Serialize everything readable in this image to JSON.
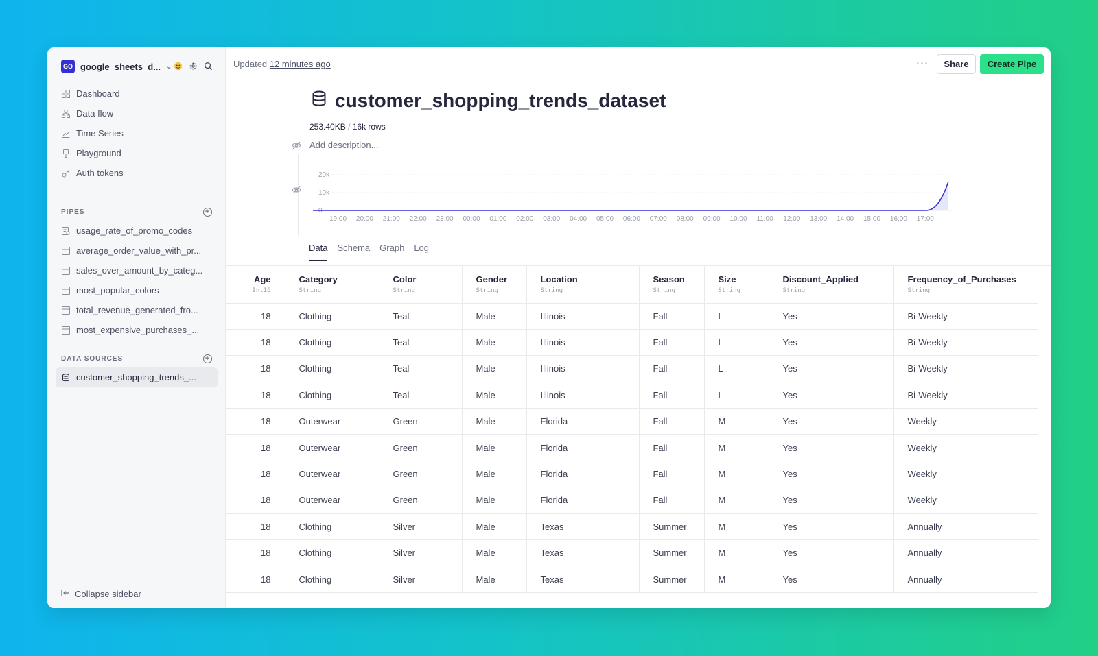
{
  "workspace": {
    "badge": "GO",
    "name": "google_sheets_d..."
  },
  "nav": [
    {
      "label": "Dashboard",
      "icon": "grid-icon"
    },
    {
      "label": "Data flow",
      "icon": "data-flow-icon"
    },
    {
      "label": "Time Series",
      "icon": "line-chart-icon"
    },
    {
      "label": "Playground",
      "icon": "playground-icon"
    },
    {
      "label": "Auth tokens",
      "icon": "key-icon"
    }
  ],
  "pipes": {
    "heading": "PIPES",
    "items": [
      "usage_rate_of_promo_codes",
      "average_order_value_with_pr...",
      "sales_over_amount_by_categ...",
      "most_popular_colors",
      "total_revenue_generated_fro...",
      "most_expensive_purchases_..."
    ]
  },
  "data_sources": {
    "heading": "DATA SOURCES",
    "items": [
      "customer_shopping_trends_..."
    ]
  },
  "collapse_label": "Collapse sidebar",
  "header": {
    "updated_prefix": "Updated",
    "updated_link": "12 minutes ago",
    "more": "···",
    "share": "Share",
    "create_pipe": "Create Pipe"
  },
  "dataset": {
    "title": "customer_shopping_trends_dataset",
    "size": "253.40KB",
    "separator": "/",
    "rows": "16k rows",
    "description_placeholder": "Add description..."
  },
  "chart_data": {
    "type": "area",
    "x": [
      "19:00",
      "20:00",
      "21:00",
      "22:00",
      "23:00",
      "00:00",
      "01:00",
      "02:00",
      "03:00",
      "04:00",
      "05:00",
      "06:00",
      "07:00",
      "08:00",
      "09:00",
      "10:00",
      "11:00",
      "12:00",
      "13:00",
      "14:00",
      "15:00",
      "16:00",
      "17:00"
    ],
    "y": [
      0,
      0,
      0,
      0,
      0,
      0,
      0,
      0,
      0,
      0,
      0,
      0,
      0,
      0,
      0,
      0,
      0,
      0,
      0,
      0,
      0,
      0,
      1500
    ],
    "end_value": 16000,
    "ytick_labels": [
      "20k",
      "10k",
      "0"
    ],
    "ylim": [
      0,
      20000
    ],
    "color": "#3530d6"
  },
  "tabs": [
    "Data",
    "Schema",
    "Graph",
    "Log"
  ],
  "table": {
    "columns": [
      {
        "name": "Age",
        "type": "Int16",
        "num": true
      },
      {
        "name": "Category",
        "type": "String"
      },
      {
        "name": "Color",
        "type": "String"
      },
      {
        "name": "Gender",
        "type": "String"
      },
      {
        "name": "Location",
        "type": "String"
      },
      {
        "name": "Season",
        "type": "String"
      },
      {
        "name": "Size",
        "type": "String"
      },
      {
        "name": "Discount_Applied",
        "type": "String"
      },
      {
        "name": "Frequency_of_Purchases",
        "type": "String"
      }
    ],
    "rows": [
      [
        "18",
        "Clothing",
        "Teal",
        "Male",
        "Illinois",
        "Fall",
        "L",
        "Yes",
        "Bi-Weekly"
      ],
      [
        "18",
        "Clothing",
        "Teal",
        "Male",
        "Illinois",
        "Fall",
        "L",
        "Yes",
        "Bi-Weekly"
      ],
      [
        "18",
        "Clothing",
        "Teal",
        "Male",
        "Illinois",
        "Fall",
        "L",
        "Yes",
        "Bi-Weekly"
      ],
      [
        "18",
        "Clothing",
        "Teal",
        "Male",
        "Illinois",
        "Fall",
        "L",
        "Yes",
        "Bi-Weekly"
      ],
      [
        "18",
        "Outerwear",
        "Green",
        "Male",
        "Florida",
        "Fall",
        "M",
        "Yes",
        "Weekly"
      ],
      [
        "18",
        "Outerwear",
        "Green",
        "Male",
        "Florida",
        "Fall",
        "M",
        "Yes",
        "Weekly"
      ],
      [
        "18",
        "Outerwear",
        "Green",
        "Male",
        "Florida",
        "Fall",
        "M",
        "Yes",
        "Weekly"
      ],
      [
        "18",
        "Outerwear",
        "Green",
        "Male",
        "Florida",
        "Fall",
        "M",
        "Yes",
        "Weekly"
      ],
      [
        "18",
        "Clothing",
        "Silver",
        "Male",
        "Texas",
        "Summer",
        "M",
        "Yes",
        "Annually"
      ],
      [
        "18",
        "Clothing",
        "Silver",
        "Male",
        "Texas",
        "Summer",
        "M",
        "Yes",
        "Annually"
      ],
      [
        "18",
        "Clothing",
        "Silver",
        "Male",
        "Texas",
        "Summer",
        "M",
        "Yes",
        "Annually"
      ]
    ]
  }
}
